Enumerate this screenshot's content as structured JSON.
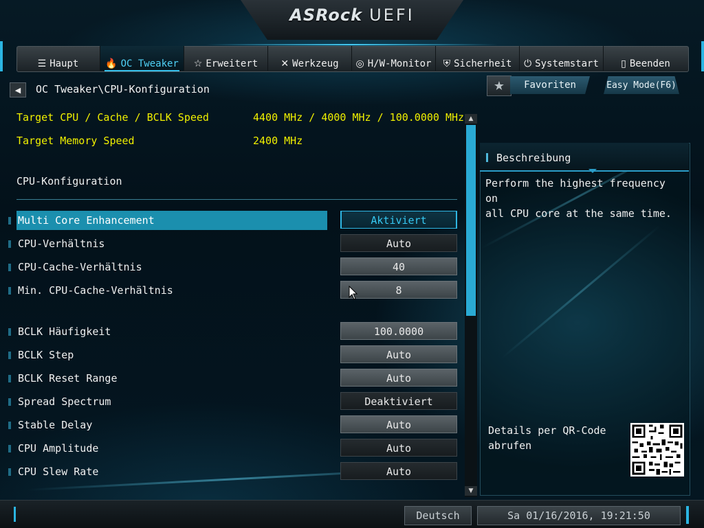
{
  "header": {
    "brand": "ASRock",
    "product": "UEFI"
  },
  "tabs": [
    {
      "icon": "☰",
      "label": "Haupt"
    },
    {
      "icon": "🔥",
      "label": "OC Tweaker"
    },
    {
      "icon": "☆",
      "label": "Erweitert"
    },
    {
      "icon": "✕",
      "label": "Werkzeug"
    },
    {
      "icon": "◎",
      "label": "H/W-Monitor"
    },
    {
      "icon": "⛨",
      "label": "Sicherheit"
    },
    {
      "icon": "⏻",
      "label": "Systemstart"
    },
    {
      "icon": "▯",
      "label": "Beenden"
    }
  ],
  "active_tab": "OC Tweaker",
  "breadcrumb": "OC Tweaker\\CPU-Konfiguration",
  "buttons": {
    "favorites": "Favoriten",
    "easy_mode": "Easy Mode(F6)"
  },
  "info": {
    "target_cpu_label": "Target CPU / Cache / BCLK Speed",
    "target_cpu_value": "4400 MHz / 4000 MHz / 100.0000 MHz",
    "target_mem_label": "Target Memory Speed",
    "target_mem_value": "2400 MHz"
  },
  "section_title": "CPU-Konfiguration",
  "settings": [
    {
      "label": "Multi Core Enhancement",
      "value": "Aktiviert"
    },
    {
      "label": "CPU-Verhältnis",
      "value": "Auto"
    },
    {
      "label": "CPU-Cache-Verhältnis",
      "value": "40"
    },
    {
      "label": "Min. CPU-Cache-Verhältnis",
      "value": "8"
    },
    {
      "label": "BCLK Häufigkeit",
      "value": "100.0000"
    },
    {
      "label": "BCLK Step",
      "value": "Auto"
    },
    {
      "label": "BCLK Reset Range",
      "value": "Auto"
    },
    {
      "label": "Spread Spectrum",
      "value": "Deaktiviert"
    },
    {
      "label": "Stable Delay",
      "value": "Auto"
    },
    {
      "label": "CPU Amplitude",
      "value": "Auto"
    },
    {
      "label": "CPU Slew Rate",
      "value": "Auto"
    }
  ],
  "scrollbar": {
    "position_fraction": 0.0
  },
  "description": {
    "title": "Beschreibung",
    "text": "Perform the highest frequency on\nall CPU core at the same time.",
    "qr_label": "Details per QR-Code abrufen"
  },
  "footer": {
    "language": "Deutsch",
    "datetime": "Sa 01/16/2016, 19:21:50"
  },
  "colors": {
    "accent": "#2bb5e2",
    "highlight": "#1b8fae",
    "yellow": "#f0f000"
  }
}
